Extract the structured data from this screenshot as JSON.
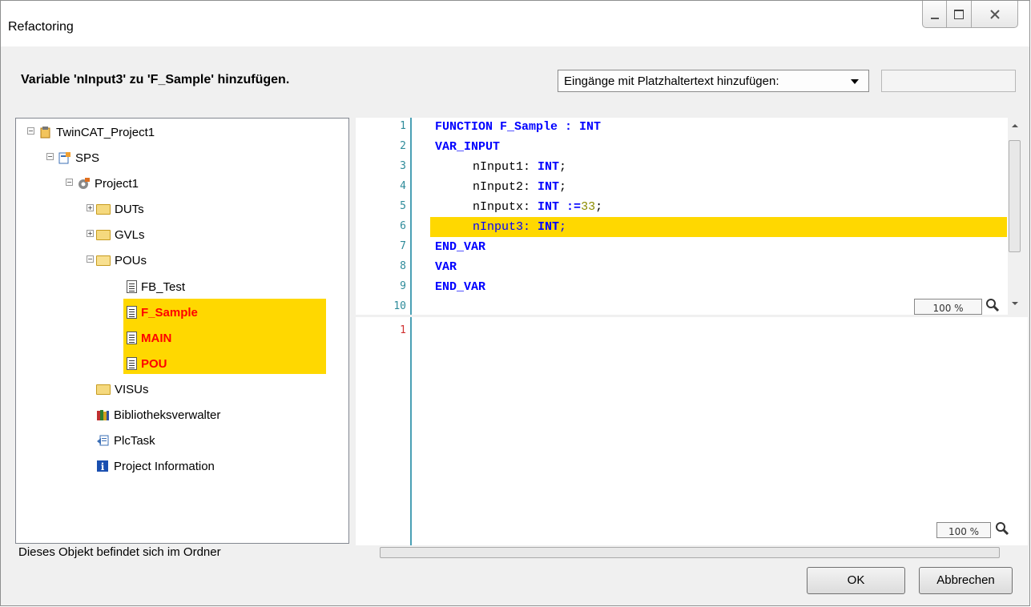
{
  "window": {
    "title": "Refactoring"
  },
  "header": {
    "message": "Variable 'nInput3' zu 'F_Sample' hinzufügen.",
    "dropdown_value": "Eingänge mit Platzhaltertext hinzufügen:"
  },
  "tree": {
    "items": [
      {
        "label": "TwinCAT_Project1",
        "icon": "project-icon"
      },
      {
        "label": "SPS",
        "icon": "plc-icon"
      },
      {
        "label": "Project1",
        "icon": "gear-icon"
      },
      {
        "label": "DUTs",
        "icon": "folder-icon"
      },
      {
        "label": "GVLs",
        "icon": "folder-icon"
      },
      {
        "label": "POUs",
        "icon": "folder-open-icon"
      },
      {
        "label": "FB_Test",
        "icon": "document-icon"
      },
      {
        "label": "F_Sample",
        "icon": "document-icon",
        "highlighted": true
      },
      {
        "label": "MAIN",
        "icon": "document-icon",
        "highlighted": true
      },
      {
        "label": "POU",
        "icon": "document-icon",
        "highlighted": true
      },
      {
        "label": "VISUs",
        "icon": "folder-icon"
      },
      {
        "label": "Bibliotheksverwalter",
        "icon": "library-icon"
      },
      {
        "label": "PlcTask",
        "icon": "task-icon"
      },
      {
        "label": "Project Information",
        "icon": "info-icon"
      }
    ],
    "status": "Dieses Objekt befindet sich im Ordner"
  },
  "editor": {
    "line_numbers": [
      "1",
      "2",
      "3",
      "4",
      "5",
      "6",
      "7",
      "8",
      "9",
      "10"
    ],
    "lines": [
      "FUNCTION F_Sample : INT",
      "VAR_INPUT",
      "nInput1: INT;",
      "nInput2: INT;",
      "nInputx: INT :=33;",
      "nInput3: INT;",
      "END_VAR",
      "VAR",
      "END_VAR"
    ],
    "zoom": "100 %",
    "second_line_numbers": [
      "1"
    ],
    "second_zoom": "100 %"
  },
  "buttons": {
    "ok": "OK",
    "cancel": "Abbrechen"
  },
  "colors": {
    "highlight": "#ffd800",
    "keyword": "#0000ff",
    "added_item": "#ff0000"
  }
}
